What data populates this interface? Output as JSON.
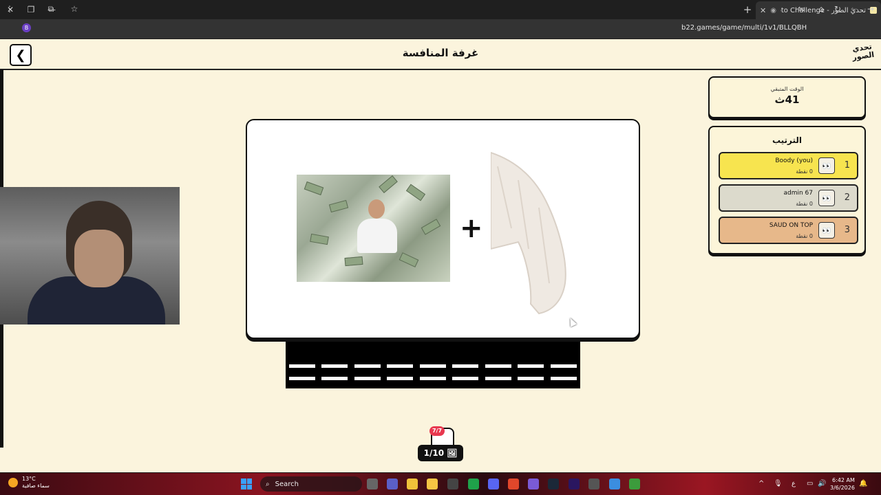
{
  "browser": {
    "tab_title": "تحدي الصور - Photo Challenge",
    "url": "b22.games/game/multi/1v1/BLLQBH",
    "profile_initial": "B"
  },
  "header": {
    "room_title": "غرفة المنافسة",
    "logo_text": "تحدي الصور",
    "back_icon": "chevron-left-icon"
  },
  "timer": {
    "label": "الوقت المتبقي",
    "value": "41ث"
  },
  "ranking": {
    "title": "الترتيب",
    "players": [
      {
        "rank": "1",
        "name": "Boody (you)",
        "points": "0 نقطة",
        "color": "#f7e44f"
      },
      {
        "rank": "2",
        "name": "admin 67",
        "points": "0 نقطة",
        "color": "#dcdacc"
      },
      {
        "rank": "3",
        "name": "SAUD ON TOP",
        "points": "0 نقطة",
        "color": "#e7b88a"
      }
    ]
  },
  "puzzle": {
    "image1": "man-with-money",
    "operator": "+",
    "image2": "white-sweater",
    "answer_slots": 9
  },
  "footer": {
    "hint_badge": "7/7",
    "counter": "1/10"
  },
  "taskbar": {
    "weather_temp": "13°C",
    "weather_desc": "سماء صافية",
    "search_label": "Search",
    "language": "ع",
    "time": "6:42 AM",
    "date": "3/6/2026"
  }
}
